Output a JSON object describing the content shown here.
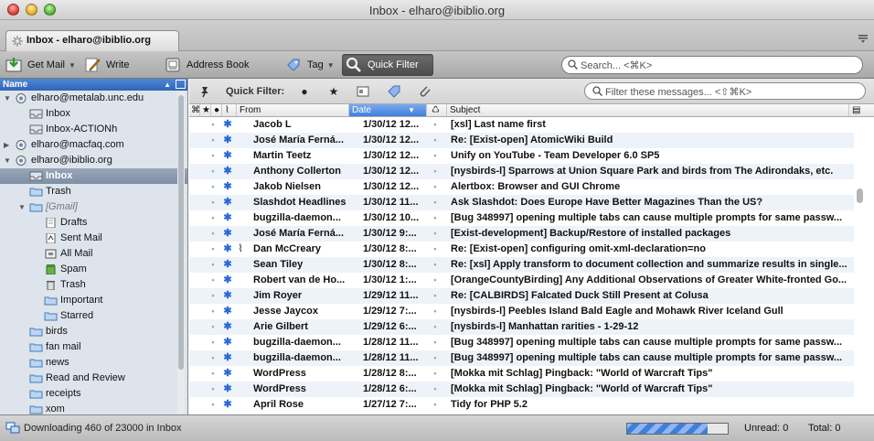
{
  "window": {
    "title": "Inbox - elharo@ibiblio.org"
  },
  "tab": {
    "label": "Inbox - elharo@ibiblio.org"
  },
  "toolbar": {
    "get_mail": "Get Mail",
    "write": "Write",
    "address_book": "Address Book",
    "tag": "Tag",
    "quick_filter": "Quick Filter",
    "search_placeholder": "Search... <⌘K>"
  },
  "folder_pane": {
    "header": "Name",
    "folders": [
      {
        "label": "elharo@metalab.unc.edu",
        "level": 0,
        "type": "account",
        "twisty": "open"
      },
      {
        "label": "Inbox",
        "level": 1,
        "type": "inbox"
      },
      {
        "label": "Inbox-ACTIONh",
        "level": 1,
        "type": "inbox"
      },
      {
        "label": "elharo@macfaq.com",
        "level": 0,
        "type": "account",
        "twisty": "closed"
      },
      {
        "label": "elharo@ibiblio.org",
        "level": 0,
        "type": "account",
        "twisty": "open"
      },
      {
        "label": "Inbox",
        "level": 1,
        "type": "inbox",
        "selected": true
      },
      {
        "label": "Trash",
        "level": 1,
        "type": "folder"
      },
      {
        "label": "[Gmail]",
        "level": 1,
        "type": "folder",
        "twisty": "open",
        "italic": true
      },
      {
        "label": "Drafts",
        "level": 2,
        "type": "drafts"
      },
      {
        "label": "Sent Mail",
        "level": 2,
        "type": "sent"
      },
      {
        "label": "All Mail",
        "level": 2,
        "type": "archive"
      },
      {
        "label": "Spam",
        "level": 2,
        "type": "spam"
      },
      {
        "label": "Trash",
        "level": 2,
        "type": "trash"
      },
      {
        "label": "Important",
        "level": 2,
        "type": "folder"
      },
      {
        "label": "Starred",
        "level": 2,
        "type": "folder"
      },
      {
        "label": "birds",
        "level": 1,
        "type": "folder"
      },
      {
        "label": "fan mail",
        "level": 1,
        "type": "folder"
      },
      {
        "label": "news",
        "level": 1,
        "type": "folder"
      },
      {
        "label": "Read and Review",
        "level": 1,
        "type": "folder"
      },
      {
        "label": "receipts",
        "level": 1,
        "type": "folder"
      },
      {
        "label": "xom",
        "level": 1,
        "type": "folder"
      }
    ]
  },
  "quick_filter_bar": {
    "label": "Quick Filter:",
    "search_placeholder": "Filter these messages... <⇧⌘K>"
  },
  "message_list": {
    "columns": {
      "from": "From",
      "date": "Date",
      "subject": "Subject"
    },
    "messages": [
      {
        "from": "Jacob L",
        "date": "1/30/12 12...",
        "subject": "[xsl] Last name first",
        "attachment": false
      },
      {
        "from": "José María Ferná...",
        "date": "1/30/12 12...",
        "subject": "Re: [Exist-open] AtomicWiki Build",
        "attachment": false
      },
      {
        "from": "Martin Teetz",
        "date": "1/30/12 12...",
        "subject": "Unify on YouTube - Team Developer 6.0 SP5",
        "attachment": false
      },
      {
        "from": "Anthony Collerton",
        "date": "1/30/12 12...",
        "subject": "[nysbirds-l] Sparrows at Union Square Park and birds from The Adirondaks, etc.",
        "attachment": false
      },
      {
        "from": "Jakob Nielsen",
        "date": "1/30/12 12...",
        "subject": "Alertbox: Browser and GUI Chrome",
        "attachment": false
      },
      {
        "from": "Slashdot Headlines",
        "date": "1/30/12 11...",
        "subject": "Ask Slashdot: Does Europe Have Better Magazines Than the US?",
        "attachment": false
      },
      {
        "from": "bugzilla-daemon...",
        "date": "1/30/12 10...",
        "subject": "[Bug 348997] opening multiple tabs can cause multiple prompts for same passw...",
        "attachment": false
      },
      {
        "from": "José María Ferná...",
        "date": "1/30/12 9:...",
        "subject": "[Exist-development] Backup/Restore of installed packages",
        "attachment": false
      },
      {
        "from": "Dan McCreary",
        "date": "1/30/12 8:...",
        "subject": "Re: [Exist-open] configuring omit-xml-declaration=no",
        "attachment": true
      },
      {
        "from": "Sean Tiley",
        "date": "1/30/12 8:...",
        "subject": "Re: [xsl] Apply transform to document collection and summarize results in single...",
        "attachment": false
      },
      {
        "from": "Robert van de Ho...",
        "date": "1/30/12 1:...",
        "subject": "[OrangeCountyBirding] Any Additional Observations of Greater White-fronted Go...",
        "attachment": false
      },
      {
        "from": "Jim Royer",
        "date": "1/29/12 11...",
        "subject": "Re: [CALBIRDS] Falcated Duck  Still Present at Colusa",
        "attachment": false
      },
      {
        "from": "Jesse Jaycox",
        "date": "1/29/12 7:...",
        "subject": "[nysbirds-l] Peebles Island Bald Eagle and Mohawk River Iceland Gull",
        "attachment": false
      },
      {
        "from": "Arie Gilbert",
        "date": "1/29/12 6:...",
        "subject": "[nysbirds-l] Manhattan rarities - 1-29-12",
        "attachment": false
      },
      {
        "from": "bugzilla-daemon...",
        "date": "1/28/12 11...",
        "subject": "[Bug 348997] opening multiple tabs can cause multiple prompts for same passw...",
        "attachment": false
      },
      {
        "from": "bugzilla-daemon...",
        "date": "1/28/12 11...",
        "subject": "[Bug 348997] opening multiple tabs can cause multiple prompts for same passw...",
        "attachment": false
      },
      {
        "from": "WordPress",
        "date": "1/28/12 8:...",
        "subject": "[Mokka mit Schlag] Pingback: \"World of Warcraft Tips\"",
        "attachment": false
      },
      {
        "from": "WordPress",
        "date": "1/28/12 6:...",
        "subject": "[Mokka mit Schlag] Pingback: \"World of Warcraft Tips\"",
        "attachment": false
      },
      {
        "from": "April Rose",
        "date": "1/27/12 7:...",
        "subject": "Tidy for PHP 5.2",
        "attachment": false
      }
    ]
  },
  "status_bar": {
    "text": "Downloading 460 of 23000 in Inbox",
    "progress": 0.8,
    "unread": "Unread: 0",
    "total": "Total: 0"
  },
  "colors": {
    "selection": "#8696ab",
    "accent": "#3f7fdc",
    "star": "#2a6ad8"
  }
}
